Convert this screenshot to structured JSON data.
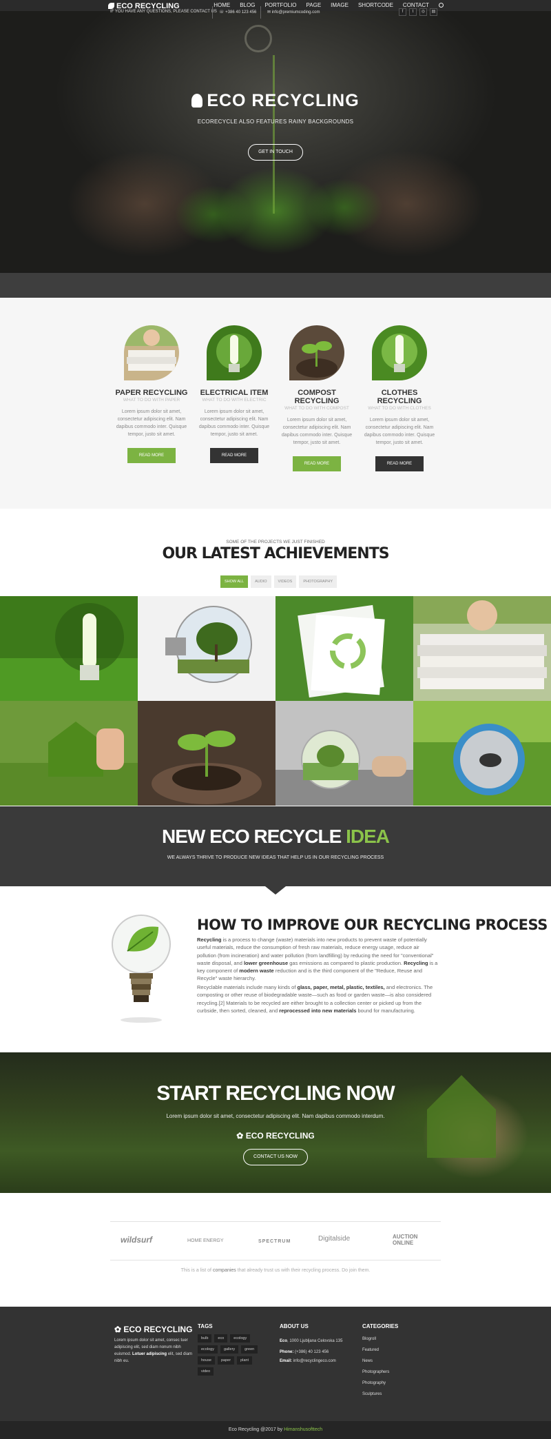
{
  "brand": {
    "name": "ECO RECYCLING",
    "top_label": "ECO RECYCLING"
  },
  "nav": {
    "items": [
      "HOME",
      "BLOG",
      "PORTFOLIO",
      "PAGE",
      "IMAGE",
      "SHORTCODE",
      "CONTACT"
    ]
  },
  "hero": {
    "title": "ECO RECYCLING",
    "subtitle": "ECORECYCLE ALSO FEATURES RAINY BACKGROUNDS",
    "button": "GET IN TOUCH"
  },
  "contact_bar": {
    "question": "IF YOU HAVE ANY QUESTIONS, PLEASE CONTACT US",
    "phone": "+386 40 123 456",
    "email": "info@premiumcoding.com",
    "social_icons": [
      "facebook-icon",
      "twitter-icon",
      "instagram-icon",
      "rss-icon"
    ]
  },
  "services": [
    {
      "title": "PAPER RECYCLING",
      "sub": "WHAT TO DO WITH PAPER",
      "text": "Lorem ipsum dolor sit amet, consectetur adipiscing elit. Nam dapibus commodo inter. Quisque tempor, justo sit amet.",
      "button": "READ MORE",
      "accent": "#7cb342"
    },
    {
      "title": "ELECTRICAL ITEM",
      "sub": "WHAT TO DO WITH ELECTRIC",
      "text": "Lorem ipsum dolor sit amet, consectetur adipiscing elit. Nam dapibus commodo inter. Quisque tempor, justo sit amet.",
      "button": "READ MORE",
      "accent": "#333333"
    },
    {
      "title": "COMPOST RECYCLING",
      "sub": "WHAT TO DO WITH COMPOST",
      "text": "Lorem ipsum dolor sit amet, consectetur adipiscing elit. Nam dapibus commodo inter. Quisque tempor, justo sit amet.",
      "button": "READ MORE",
      "accent": "#7cb342"
    },
    {
      "title": "CLOTHES RECYCLING",
      "sub": "WHAT TO DO WITH CLOTHES",
      "text": "Lorem ipsum dolor sit amet, consectetur adipiscing elit. Nam dapibus commodo inter. Quisque tempor, justo sit amet.",
      "button": "READ MORE",
      "accent": "#333333"
    }
  ],
  "achievements": {
    "pretitle": "SOME OF THE PROJECTS WE JUST FINISHED",
    "title": "OUR LATEST ACHIEVEMENTS",
    "filters": [
      "SHOW ALL",
      "AUDIO",
      "VIDEOS",
      "PHOTOGRAPHY"
    ]
  },
  "idea": {
    "title_main": "NEW ECO RECYCLE",
    "title_accent": "IDEA",
    "subtitle": "WE ALWAYS THRIVE TO PRODUCE NEW IDEAS THAT HELP US IN OUR RECYCLING PROCESS"
  },
  "howto": {
    "title": "HOW TO IMPROVE OUR RECYCLING PROCESS",
    "p1_a": "Recycling",
    "p1_b": " is a process to change (waste) materials into new products to prevent waste of potentially useful materials, reduce the consumption of fresh raw materials, reduce energy usage, reduce air pollution (from incineration) and water pollution (from landfilling) by reducing the need for \"conventional\" waste disposal, and ",
    "p1_c": "lower greenhouse",
    "p1_d": " gas emissions as compared to plastic production. ",
    "p1_e": "Recycling",
    "p1_f": " is a key component of ",
    "p1_g": "modern waste",
    "p1_h": " reduction and is the third component of the \"Reduce, Reuse and Recycle\" waste hierarchy.",
    "p2_a": "Recyclable materials include many kinds of ",
    "p2_b": "glass, paper, metal, plastic, textiles,",
    "p2_c": " and electronics. The composting or other reuse of biodegradable waste—such as food or garden waste—is also considered recycling.[2] Materials to be recycled are either brought to a collection center or picked up from the curbside, then sorted, cleaned, and ",
    "p2_d": "reprocessed into new materials",
    "p2_e": " bound for manufacturing."
  },
  "cta": {
    "title": "START RECYCLING NOW",
    "subtitle": "Lorem ipsum dolor sit amet, consectetur adipiscing elit. Nam dapibus commodo interdum.",
    "logo": "ECO RECYCLING",
    "button": "CONTACT US NOW"
  },
  "partners": {
    "logos": [
      "wildsurf",
      "HOME ENERGY",
      "SPECTRUM",
      "Digitalside",
      "AUCTION ONLINE"
    ],
    "note_a": "This is a list of ",
    "note_b": "companies",
    "note_c": " that already trust us with their recycling process. Do join them."
  },
  "footer": {
    "logo": "ECO RECYCLING",
    "text_a": "Lorem ipsum dolor sit amet, consec tuer adipiscing elit, sed diam nonum nibh euismod. ",
    "text_b": "Lotuer adipiscing",
    "text_c": " elit, sed diam nibh eu.",
    "tags_heading": "TAGS",
    "tags": [
      "bulb",
      "eco",
      "ecology",
      "ecology",
      "gallery",
      "green",
      "house",
      "paper",
      "plant",
      "video"
    ],
    "about_heading": "ABOUT US",
    "address_b": "Eco",
    "address": ", 1000 Ljubljana Celovska 135",
    "phone_label": "Phone:",
    "phone": " (+386) 40 123 456",
    "email_label": "Email:",
    "email": " info@recyclingeco.com",
    "categories_heading": "CATEGORIES",
    "categories": [
      "Blogroll",
      "Featured",
      "News",
      "Photographers",
      "Photography",
      "Sculptures"
    ],
    "copyright": "Eco Recycling @2017 by ",
    "copyright_link": "Himanshusofttech"
  },
  "colors": {
    "accent": "#7cb342",
    "dark": "#333333",
    "footer": "#333333"
  }
}
